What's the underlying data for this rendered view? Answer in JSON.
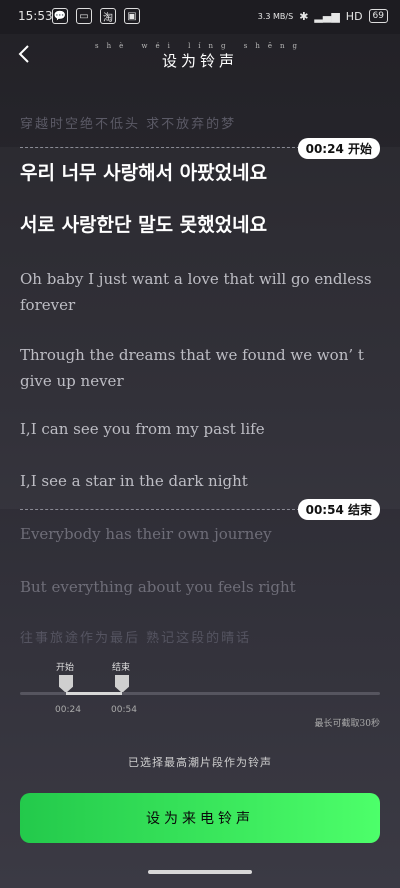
{
  "status": {
    "time": "15:53",
    "apps": [
      "💬",
      "▭",
      "淘",
      "▣"
    ],
    "net": "3.3 MB/S",
    "hd": "HD",
    "battery": "69"
  },
  "header": {
    "title": "设为铃声",
    "title_pinyin": "shè wéi líng shēng"
  },
  "lyrics": {
    "prev": "穿越时空绝不低头 求不放弃的梦",
    "line1": "우리 너무 사랑해서 아팠었네요",
    "line2": "서로 사랑한단 말도 못했었네요",
    "line3": "Oh baby I just want a love that will go endless forever",
    "line4": "Through the dreams that we found we won’ t give up never",
    "line5": "I,I can see you from my past life",
    "line6": "I,I see a star in the dark night",
    "line7": "Everybody has their own journey",
    "line8": "But everything about you feels right",
    "line9": "往事旅途作为最后 熟记这段的晴话"
  },
  "markers": {
    "start": "00:24 开始",
    "end": "00:54 结束"
  },
  "trim": {
    "start_label": "开始",
    "start_time": "00:24",
    "end_label": "结束",
    "end_time": "00:54",
    "max_note": "最长可截取30秒",
    "start_fraction": 0.13,
    "end_fraction": 0.28
  },
  "hint": "已选择最高潮片段作为铃声",
  "cta": "设为来电铃声",
  "icons": {
    "back": "back-arrow-icon",
    "bluetooth": "bluetooth-icon"
  }
}
